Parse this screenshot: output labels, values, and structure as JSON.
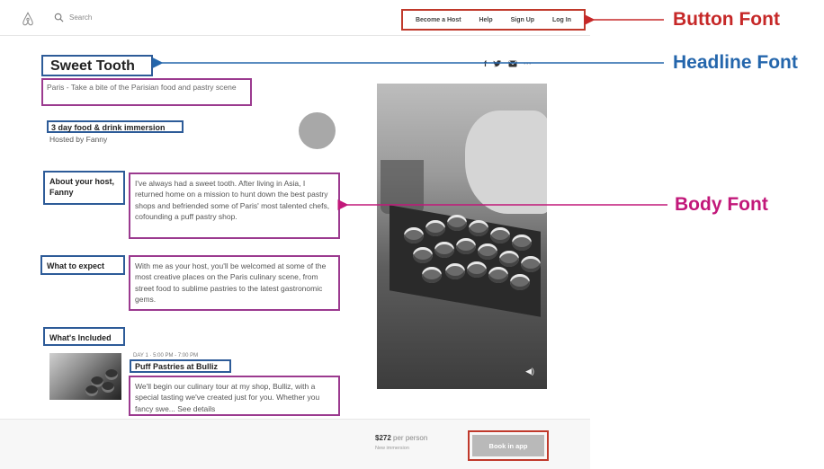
{
  "nav": {
    "search_placeholder": "Search",
    "links": [
      "Become a Host",
      "Help",
      "Sign Up",
      "Log In"
    ]
  },
  "social_icons": [
    "facebook-icon",
    "twitter-icon",
    "email-icon",
    "more-icon"
  ],
  "listing": {
    "title": "Sweet Tooth",
    "subtitle": "Paris - Take a bite of the Parisian food and pastry scene",
    "immersion": "3 day food & drink immersion",
    "hosted_by": "Hosted by Fanny",
    "about_label": "About your host, Fanny",
    "about_text": "I've always had a sweet tooth. After living in Asia, I returned home on a mission to hunt down the best pastry shops and befriended some of Paris' most talented chefs, cofounding a puff pastry shop.",
    "expect_label": "What to expect",
    "expect_text": "With me as your host, you'll be welcomed at some of the most creative places on the Paris culinary scene, from street food to sublime pastries to the latest gastronomic gems.",
    "included_label": "What's Included",
    "day_label": "DAY 1 · 5:00 PM - 7:00 PM",
    "puff_title": "Puff Pastries at Bulliz",
    "puff_text": "We'll begin our culinary tour at my shop, Bulliz, with a special tasting we've created just for you. Whether you fancy swe... See details"
  },
  "footer": {
    "price": "$272",
    "per_person": "per person",
    "new_immersion": "New immersion",
    "book_button": "Book in app"
  },
  "annotations": {
    "button_font": "Button Font",
    "headline_font": "Headline Font",
    "body_font": "Body Font"
  },
  "colors": {
    "button_annotation": "#c62828",
    "headline_annotation": "#2466ac",
    "body_annotation": "#c2187a"
  }
}
